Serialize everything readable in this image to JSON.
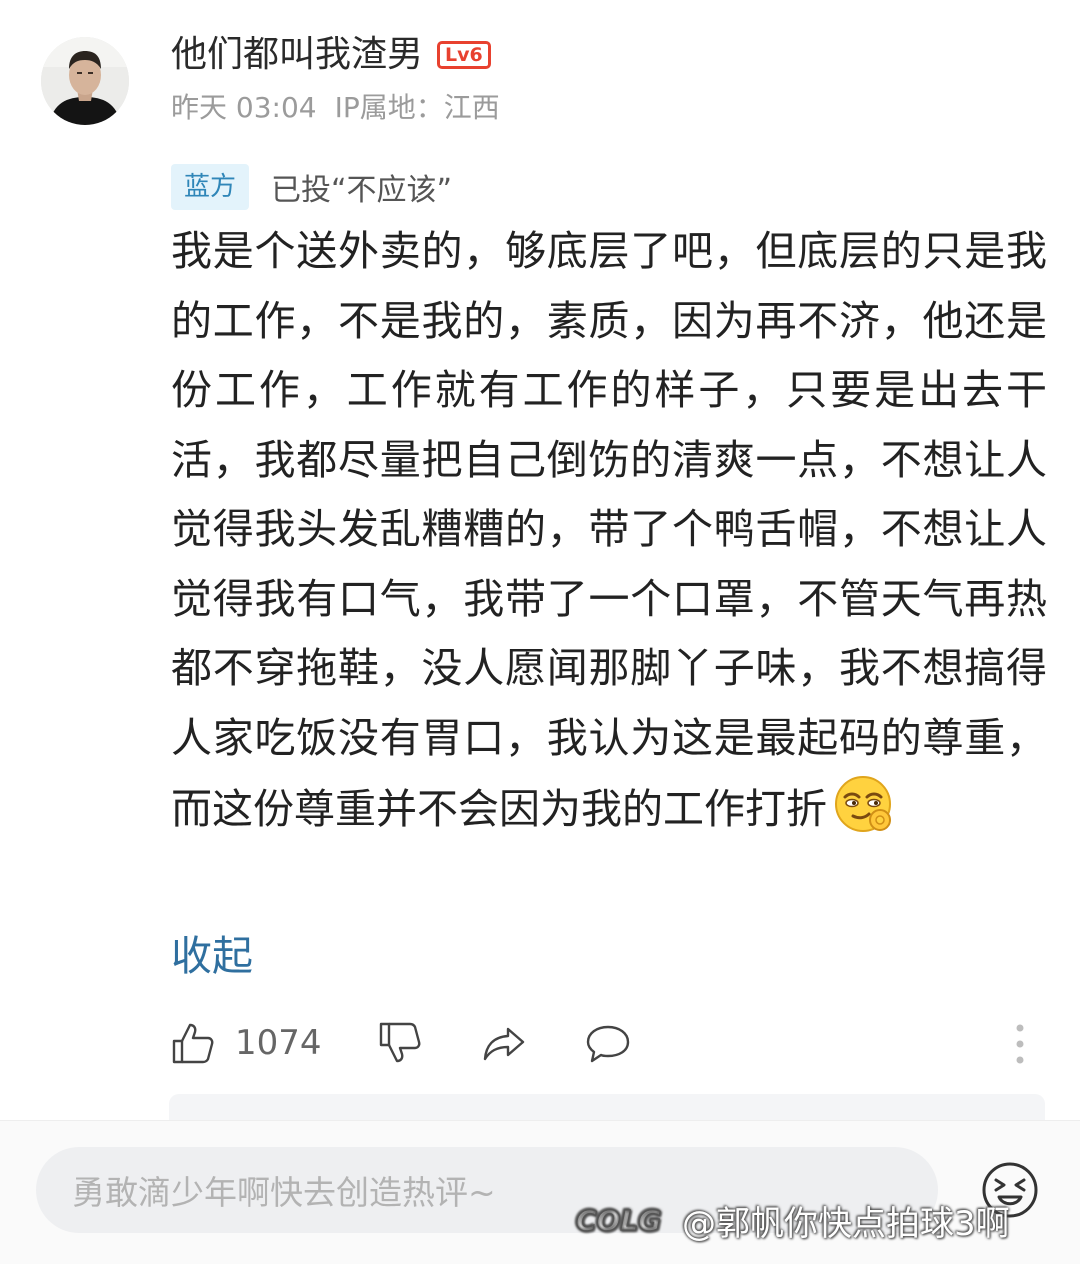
{
  "user": {
    "name": "他们都叫我渣男",
    "level": "Lv6",
    "time": "昨天 03:04",
    "ip_location": "IP属地：江西"
  },
  "vote": {
    "side": "蓝方",
    "status": "已投“不应该”"
  },
  "comment": {
    "text": "我是个送外卖的，够底层了吧，但底层的只是我的工作，不是我的，素质，因为再不济，他还是份工作，工作就有工作的样子，只要是出去干活，我都尽量把自己倒饬的清爽一点，不想让人觉得我头发乱糟糟的，带了个鸭舌帽，不想让人觉得我有口气，我带了一个口罩，不管天气再热都不穿拖鞋，没人愿闻那脚丫子味，我不想搞得人家吃饭没有胃口，我认为这是最起码的尊重，而这份尊重并不会因为我的工作打折",
    "collapse_label": "收起",
    "emoji": "smirk-ok-emoji"
  },
  "actions": {
    "like_count": "1074",
    "icons": [
      "thumbs-up-icon",
      "thumbs-down-icon",
      "share-icon",
      "comment-icon",
      "more-icon"
    ]
  },
  "reply_bar": {
    "placeholder": "勇敢滴少年啊快去创造热评~",
    "emoji_button": "emoji-icon"
  },
  "watermark": {
    "logo": "COLG",
    "text": "@郭帆你快点拍球3啊"
  },
  "colors": {
    "level_badge": "#e8412f",
    "side_tag_bg": "#e3f3fb",
    "side_tag_text": "#2f86b8",
    "link": "#2f6f9f"
  }
}
